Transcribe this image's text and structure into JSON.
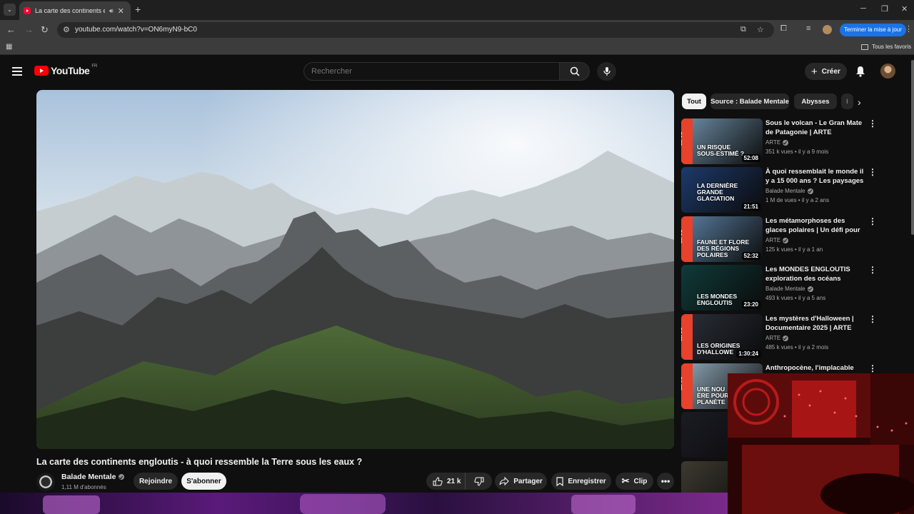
{
  "browser": {
    "tab_title": "La carte des continents englo",
    "url": "youtube.com/watch?v=ON6myN9-bC0",
    "update_button": "Terminer la mise à jour",
    "bookmarks_all": "Tous les favoris"
  },
  "header": {
    "logo_text": "YouTube",
    "region": "FR",
    "search_placeholder": "Rechercher",
    "create_label": "Créer"
  },
  "video": {
    "title": "La carte des continents engloutis - à quoi ressemble la Terre sous les eaux ?",
    "channel": "Balade Mentale",
    "subscribers": "1,11 M d'abonnés",
    "join_label": "Rejoindre",
    "subscribe_label": "S'abonner",
    "likes": "21 k",
    "share_label": "Partager",
    "save_label": "Enregistrer",
    "clip_label": "Clip"
  },
  "chips": [
    "Tout",
    "Source : Balade Mentale",
    "Abysses",
    "I"
  ],
  "recommendations": [
    {
      "title": "Sous le volcan - Le Gran Mate de Patagonie | ARTE",
      "channel": "ARTE",
      "views": "351 k vues",
      "age": "il y a 9 mois",
      "duration": "52:08",
      "overlay": "UN RISQUE\nSOUS-ESTIMÉ ?",
      "arte": true,
      "bg": "#6e8fa8"
    },
    {
      "title": "À quoi ressemblait le monde il y a 15 000 ans ? Les paysages ...",
      "channel": "Balade Mentale",
      "views": "1 M de vues",
      "age": "il y a 2 ans",
      "duration": "21:51",
      "overlay": "LA DERNIÈRE GRANDE\nGLACIATION",
      "arte": false,
      "bg": "#1d3a6b"
    },
    {
      "title": "Les métamorphoses des glaces polaires | Un défi pour les ...",
      "channel": "ARTE",
      "views": "125 k vues",
      "age": "il y a 1 an",
      "duration": "52:32",
      "overlay": "FAUNE ET FLORE\nDES RÉGIONS\nPOLAIRES",
      "arte": true,
      "bg": "#5a7fa1"
    },
    {
      "title": "Les MONDES ENGLOUTIS exploration des océans",
      "channel": "Balade Mentale",
      "views": "493 k vues",
      "age": "il y a 5 ans",
      "duration": "23:20",
      "overlay": "LES MONDES\nENGLOUTIS",
      "arte": false,
      "bg": "#0f3b3a"
    },
    {
      "title": "Les mystères d'Halloween | Documentaire 2025 | ARTE",
      "channel": "ARTE",
      "views": "485 k vues",
      "age": "il y a 2 mois",
      "duration": "1:30:24",
      "overlay": "LES ORIGINES\nD'HALLOWE",
      "arte": true,
      "bg": "#2b2f3a"
    },
    {
      "title": "Anthropocène, l'implacable",
      "channel": "",
      "views": "",
      "age": "",
      "duration": "",
      "overlay": "UNE NOU\nÈRE POUR\nPLANÈTE",
      "arte": true,
      "bg": "#8fa7b8"
    },
    {
      "title": "",
      "channel": "",
      "views": "",
      "age": "",
      "duration": "",
      "overlay": "",
      "arte": false,
      "bg": "#1b1b24"
    },
    {
      "title": "",
      "channel": "",
      "views": "",
      "age": "",
      "duration": "",
      "overlay": "",
      "arte": false,
      "bg": "#3d3a30"
    }
  ]
}
